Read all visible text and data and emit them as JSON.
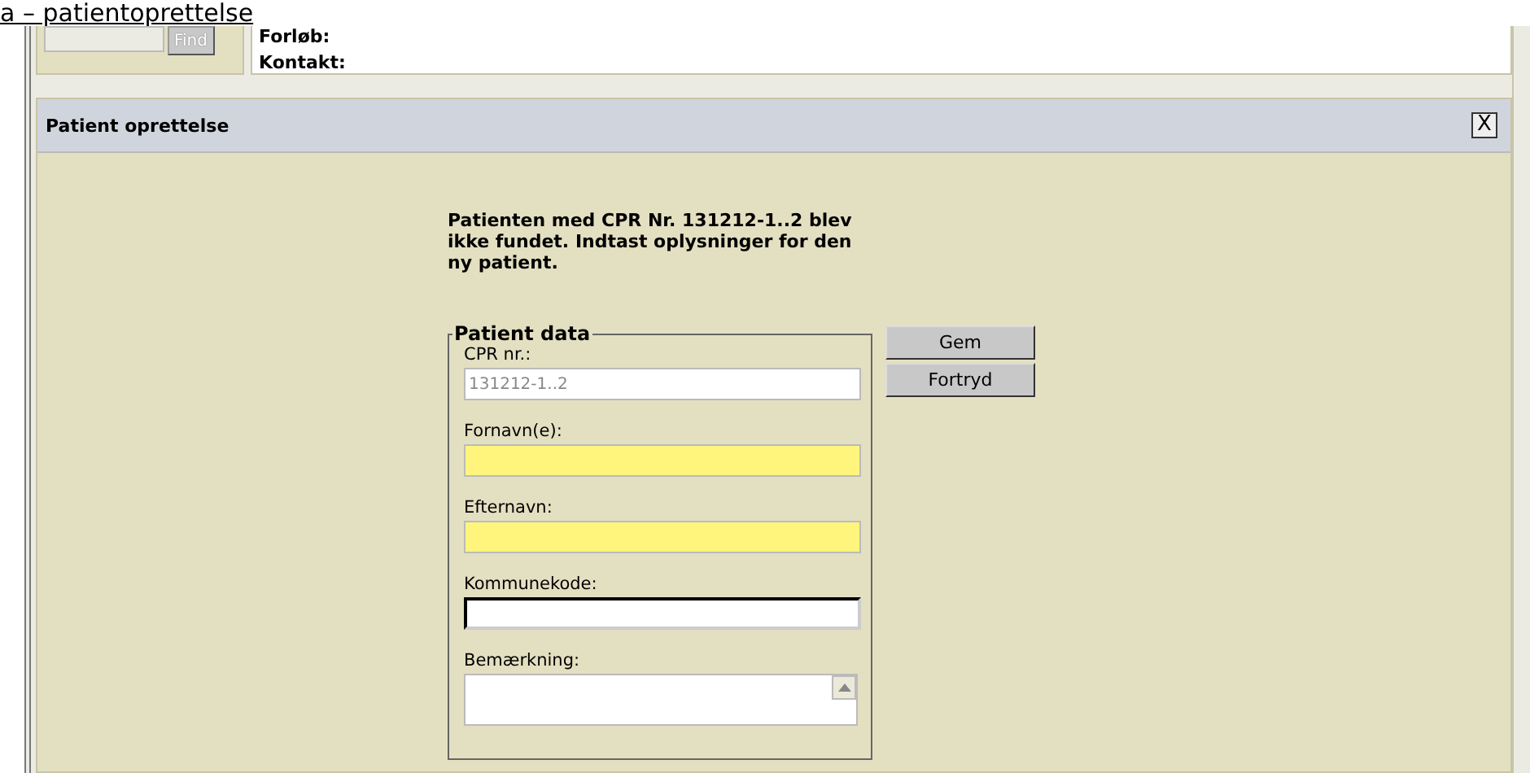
{
  "heading": "a – patientoprettelse",
  "search": {
    "button": "Find"
  },
  "info": [
    "Forløb:",
    "Kontakt:"
  ],
  "panel": {
    "title": "Patient oprettelse",
    "close": "X",
    "message": "Patienten med CPR Nr. 131212-1..2 blev ikke fundet. Indtast oplysninger for den ny patient.",
    "group": "Patient data",
    "fields": [
      {
        "label": "CPR nr.:",
        "kind": "input",
        "value": "131212-1..2",
        "disabled": true,
        "required": false
      },
      {
        "label": "Fornavn(e):",
        "kind": "input",
        "disabled": false,
        "required": true
      },
      {
        "label": "Efternavn:",
        "kind": "input",
        "disabled": false,
        "required": true
      },
      {
        "label": "Kommunekode:",
        "kind": "input",
        "disabled": false,
        "required": false
      },
      {
        "label": "Bemærkning:",
        "kind": "textarea",
        "disabled": false,
        "required": false
      }
    ],
    "buttons": [
      "Gem",
      "Fortryd"
    ]
  }
}
